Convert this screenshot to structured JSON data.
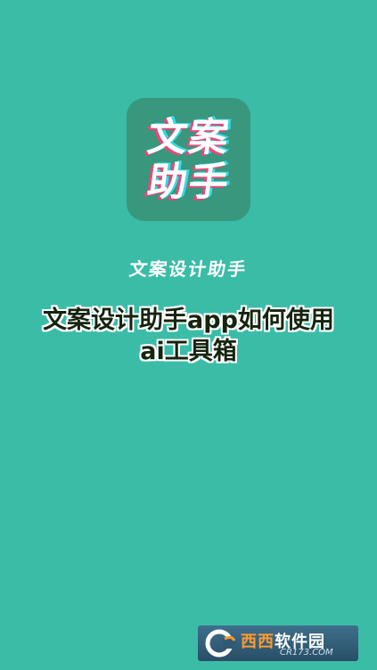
{
  "colors": {
    "background": "#3bbca7",
    "icon_background": "#38977d",
    "headline_text": "#15240d",
    "watermark_accent": "#ff9a2e"
  },
  "app_icon": {
    "line1": "文案",
    "line2": "助手"
  },
  "app_name": "文案设计助手",
  "headline": {
    "line1": "文案设计助手app如何使用",
    "line2": "ai工具箱"
  },
  "watermark": {
    "logo_icon": "cr-logo-icon",
    "brand_accent": "西西",
    "brand_suffix": "软件园",
    "domain": "CR173.COM"
  }
}
